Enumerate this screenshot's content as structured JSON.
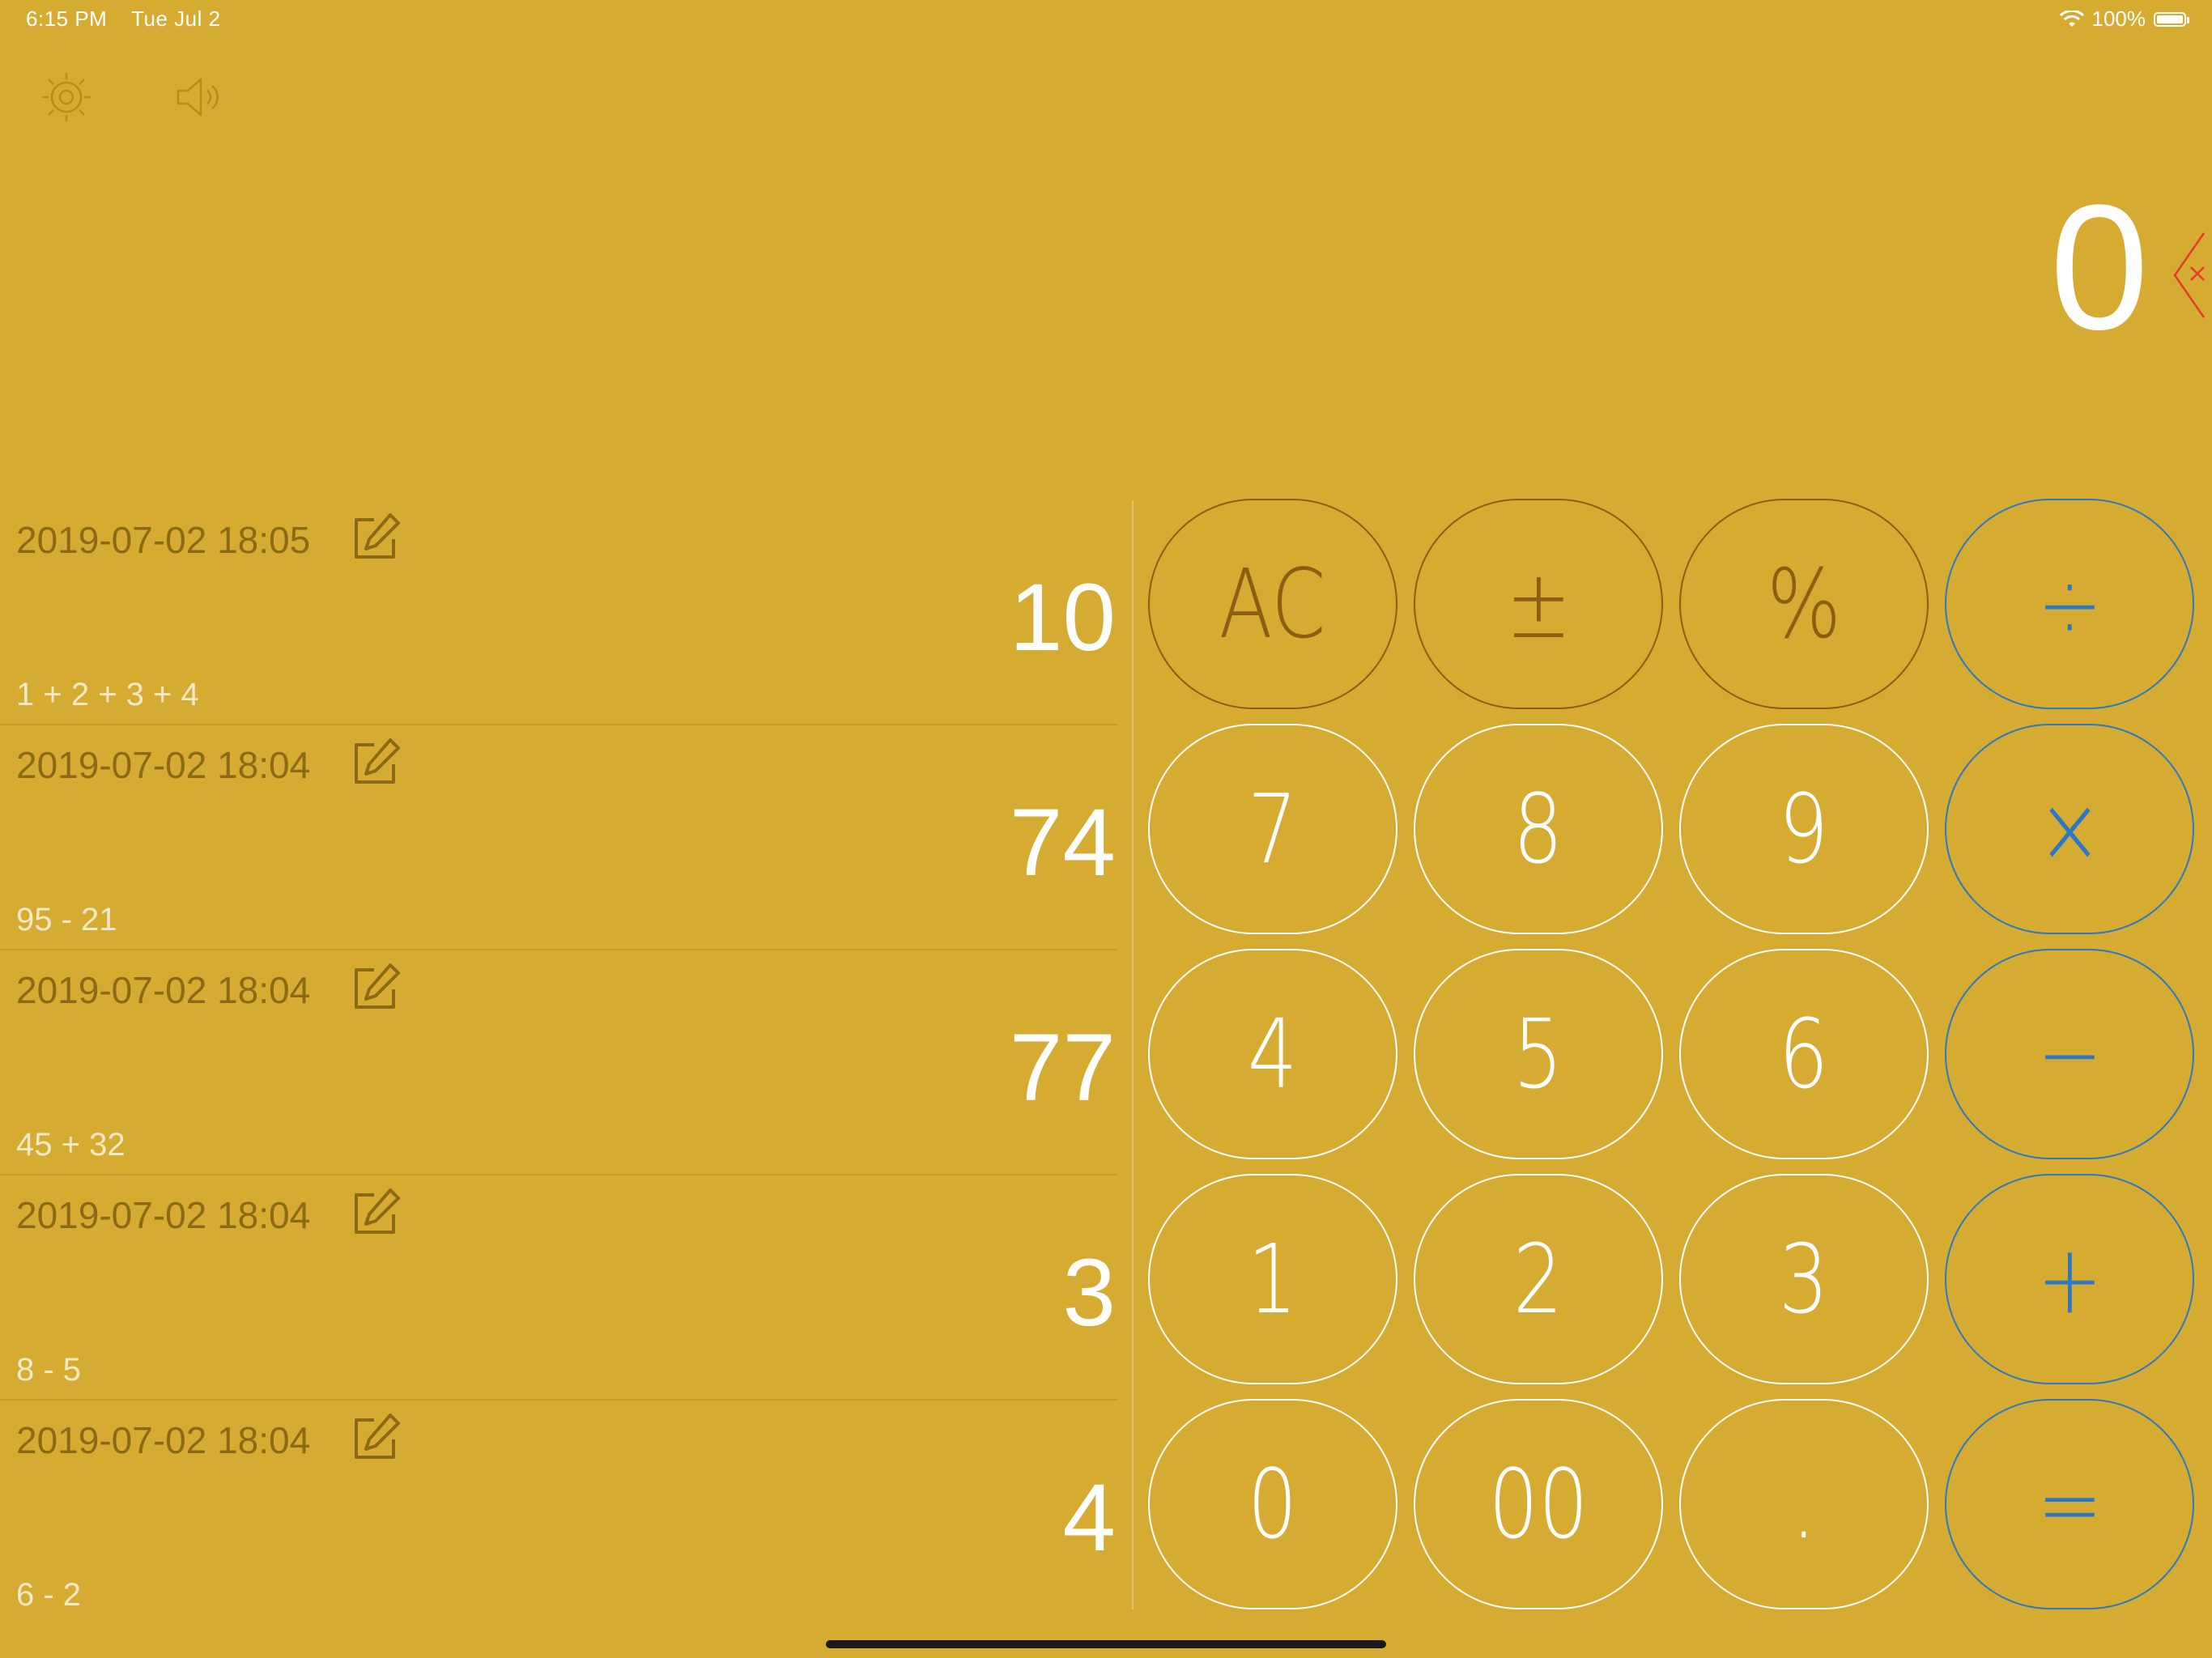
{
  "status_bar": {
    "time": "6:15 PM",
    "date": "Tue Jul 2",
    "battery": "100%",
    "battery_level": 1.0
  },
  "toolbar": {
    "settings_icon": "gear-icon",
    "sound_icon": "speaker-icon"
  },
  "display": {
    "value": "0",
    "delete_icon": "backspace-icon"
  },
  "history": [
    {
      "date": "2019-07-02 18:05",
      "result": "10",
      "expression": "1 + 2 + 3 + 4"
    },
    {
      "date": "2019-07-02 18:04",
      "result": "74",
      "expression": "95 - 21"
    },
    {
      "date": "2019-07-02 18:04",
      "result": "77",
      "expression": "45 + 32"
    },
    {
      "date": "2019-07-02 18:04",
      "result": "3",
      "expression": "8 - 5"
    },
    {
      "date": "2019-07-02 18:04",
      "result": "4",
      "expression": "6 - 2"
    }
  ],
  "keys": {
    "ac": "AC",
    "plus_minus": "±",
    "percent": "%",
    "divide": "÷",
    "seven": "7",
    "eight": "8",
    "nine": "9",
    "multiply": "×",
    "four": "4",
    "five": "5",
    "six": "6",
    "minus": "−",
    "one": "1",
    "two": "2",
    "three": "3",
    "plus": "+",
    "zero": "0",
    "double_zero": "00",
    "decimal": ".",
    "equals": "="
  },
  "colors": {
    "background": "#D5AB32",
    "function_key": "#8B5E12",
    "operator_key": "#2C78C4",
    "digit_key": "#FFFFFF",
    "delete_icon": "#E53B2C",
    "history_date": "#8B6A14"
  }
}
